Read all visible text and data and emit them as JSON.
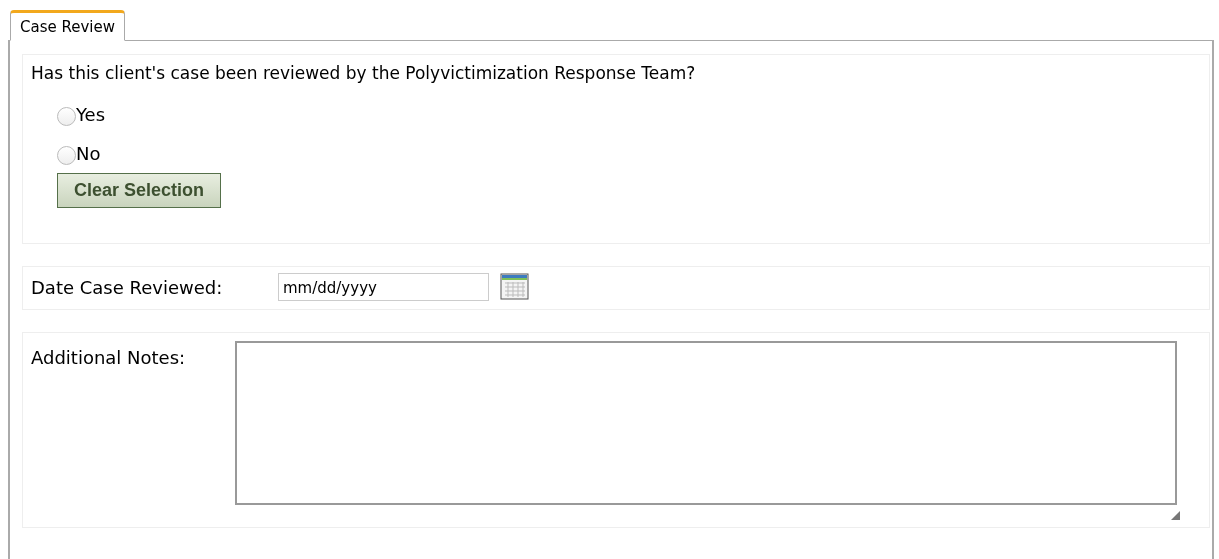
{
  "tabs": [
    {
      "label": "Case Review",
      "selected": true
    }
  ],
  "question": {
    "text": "Has this client's case been reviewed by the Polyvictimization Response Team?",
    "options": [
      {
        "label": "Yes",
        "selected": false
      },
      {
        "label": "No",
        "selected": false
      }
    ],
    "clear_button": "Clear Selection"
  },
  "date_field": {
    "label": "Date Case Reviewed:",
    "value": "mm/dd/yyyy"
  },
  "notes_field": {
    "label": "Additional Notes:"
  }
}
